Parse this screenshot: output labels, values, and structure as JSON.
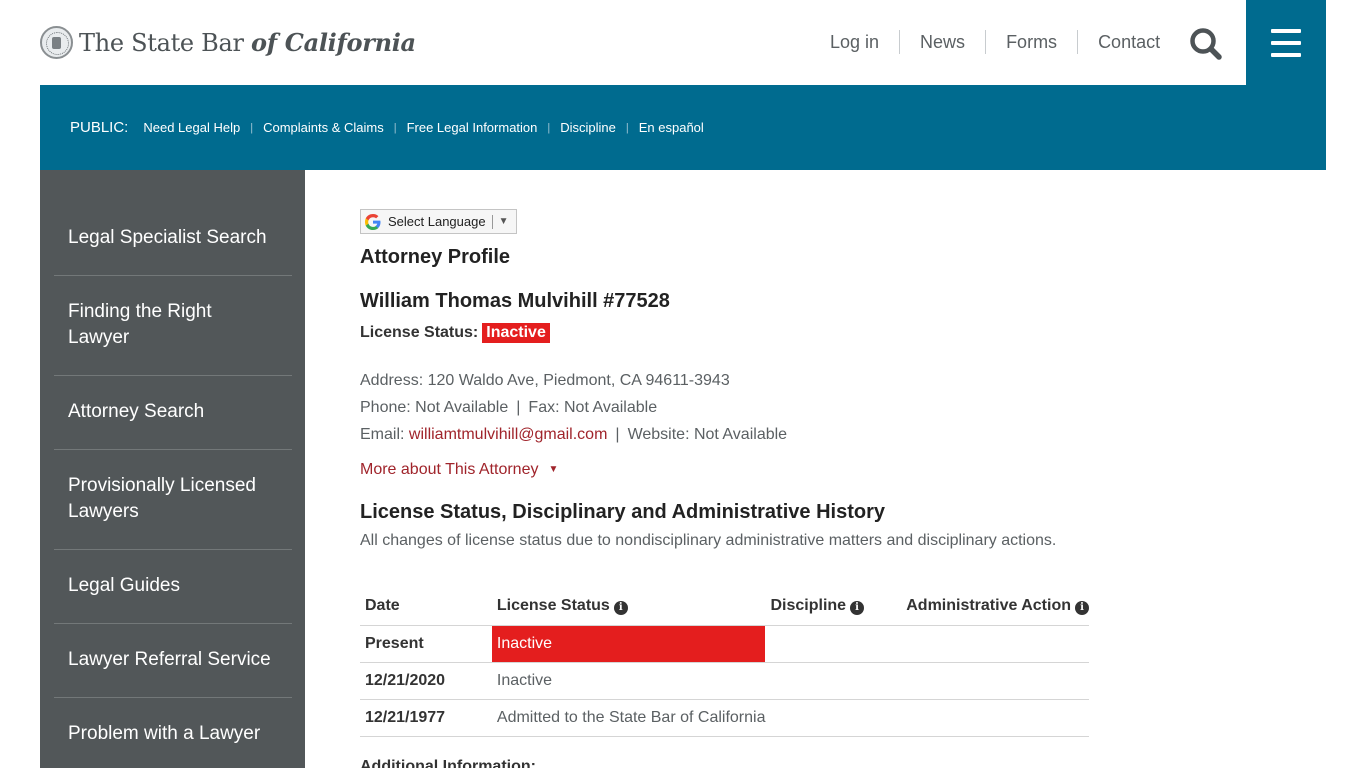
{
  "header": {
    "logo": {
      "part1": "The State Bar ",
      "part2": "of California"
    },
    "nav": [
      "Log in",
      "News",
      "Forms",
      "Contact"
    ]
  },
  "public_bar": {
    "label": "PUBLIC:",
    "links": [
      "Need Legal Help",
      "Complaints & Claims",
      "Free Legal Information",
      "Discipline",
      "En español"
    ]
  },
  "sidebar": {
    "items": [
      "Legal Specialist Search",
      "Finding the Right Lawyer",
      "Attorney Search",
      "Provisionally Licensed Lawyers",
      "Legal Guides",
      "Lawyer Referral Service",
      "Problem with a Lawyer"
    ]
  },
  "translate": {
    "label": "Select Language",
    "arrow": "▼"
  },
  "profile": {
    "heading": "Attorney Profile",
    "name": "William Thomas Mulvihill #77528",
    "status_label": "License Status:",
    "status_value": "Inactive",
    "address": "Address: 120 Waldo Ave, Piedmont, CA 94611-3943",
    "phone": "Phone: Not Available",
    "fax": "Fax: Not Available",
    "email_label": "Email: ",
    "email": "williamtmulvihill@gmail.com",
    "website": "Website: Not Available",
    "more_label": "More about This Attorney"
  },
  "history": {
    "heading": "License Status, Disciplinary and Administrative History",
    "description": "All changes of license status due to nondisciplinary administrative matters and disciplinary actions.",
    "columns": [
      "Date",
      "License Status",
      "Discipline",
      "Administrative Action"
    ],
    "rows": [
      {
        "date": "Present",
        "status": "Inactive",
        "discipline": "",
        "admin": ""
      },
      {
        "date": "12/21/2020",
        "status": "Inactive",
        "discipline": "",
        "admin": ""
      },
      {
        "date": "12/21/1977",
        "status": "Admitted to the State Bar of California",
        "discipline": "",
        "admin": ""
      }
    ],
    "additional_label": "Additional Information:"
  },
  "colors": {
    "brand_blue": "#006b8f",
    "sidebar_gray": "#525759",
    "status_red": "#e41e1e",
    "link_red": "#a0242b"
  }
}
